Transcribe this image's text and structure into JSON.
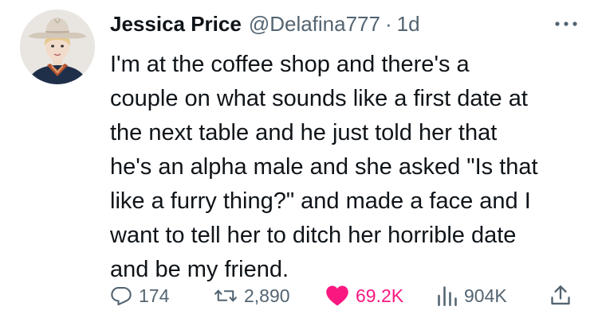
{
  "author": {
    "name": "Jessica Price",
    "handle": "@Delafina777",
    "separator": "·",
    "time": "1d"
  },
  "tweet": {
    "lines": [
      "I'm at the coffee shop and there's a",
      "couple on what sounds like a first date at",
      "the next table and he just told her that",
      "he's an alpha male and she asked \"Is that",
      "like a furry thing?\" and made a face and I",
      "want to tell her to ditch her horrible date",
      "and be my friend."
    ]
  },
  "stats": {
    "replies": "174",
    "retweets": "2,890",
    "likes": "69.2K",
    "views": "904K"
  },
  "icons": {
    "reply": "reply-icon",
    "retweet": "retweet-icon",
    "like": "heart-icon",
    "views": "views-icon",
    "share": "share-icon",
    "more": "more-icon"
  },
  "colors": {
    "text": "#0f1419",
    "muted": "#536471",
    "like": "#f91880"
  }
}
